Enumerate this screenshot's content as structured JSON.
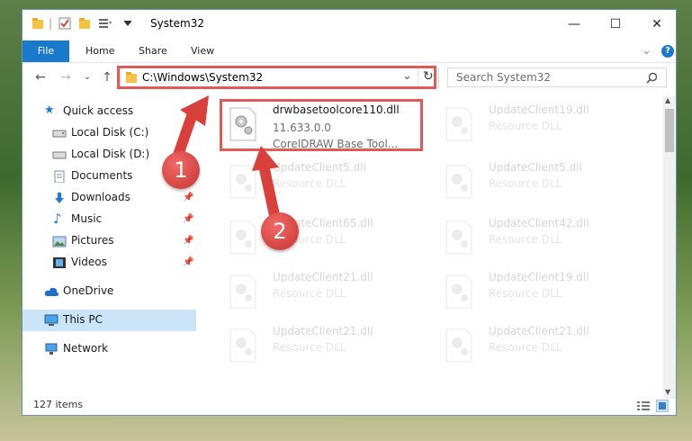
{
  "window": {
    "title": "System32",
    "controls": {
      "minimize": "—",
      "maximize": "☐",
      "close": "✕"
    }
  },
  "ribbon": {
    "tabs": [
      {
        "label": "File"
      },
      {
        "label": "Home"
      },
      {
        "label": "Share"
      },
      {
        "label": "View"
      }
    ],
    "chevron": "⌄",
    "help": "?"
  },
  "address_bar": {
    "path": "C:\\Windows\\System32",
    "dropdown": "⌄",
    "refresh": "↻"
  },
  "search": {
    "placeholder": "Search System32"
  },
  "sidebar": {
    "items": [
      {
        "label": "Quick access",
        "icon": "star-icon"
      },
      {
        "label": "Local Disk (C:)",
        "icon": "drive-icon"
      },
      {
        "label": "Local Disk (D:)",
        "icon": "drive-icon"
      },
      {
        "label": "Documents",
        "icon": "documents-icon",
        "pinned": true
      },
      {
        "label": "Downloads",
        "icon": "download-arrow-icon",
        "pinned": true
      },
      {
        "label": "Music",
        "icon": "music-note-icon",
        "pinned": true
      },
      {
        "label": "Pictures",
        "icon": "pictures-icon",
        "pinned": true
      },
      {
        "label": "Videos",
        "icon": "film-icon",
        "pinned": true
      },
      {
        "label": "OneDrive",
        "icon": "cloud-icon"
      },
      {
        "label": "This PC",
        "icon": "computer-icon"
      },
      {
        "label": "Network",
        "icon": "network-icon"
      }
    ]
  },
  "files": [
    {
      "name": "drwbasetoolcore110.dll",
      "version": "11.633.0.0",
      "desc": "CorelDRAW Base Tool..."
    },
    {
      "name": "UpdateClient19.dll",
      "desc": "Resource DLL"
    },
    {
      "name": "UpdateClient5.dll",
      "desc": "Resource DLL"
    },
    {
      "name": "UpdateClient5.dll",
      "desc": "Resource DLL"
    },
    {
      "name": "UpdateClient65.dll",
      "desc": "Resource DLL"
    },
    {
      "name": "UpdateClient42.dll",
      "desc": "Resource DLL"
    },
    {
      "name": "UpdateClient21.dll",
      "desc": "Resource DLL"
    },
    {
      "name": "UpdateClient19.dll",
      "desc": "Resource DLL"
    },
    {
      "name": "UpdateClient21.dll",
      "desc": "Resource DLL"
    },
    {
      "name": "UpdateClient21.dll",
      "desc": "Resource DLL"
    }
  ],
  "status": {
    "item_count": "127 items"
  },
  "callouts": {
    "one": "1",
    "two": "2"
  },
  "colors": {
    "accent": "#1979ca",
    "highlight": "#e05a5a",
    "selection": "#cce4f7"
  }
}
